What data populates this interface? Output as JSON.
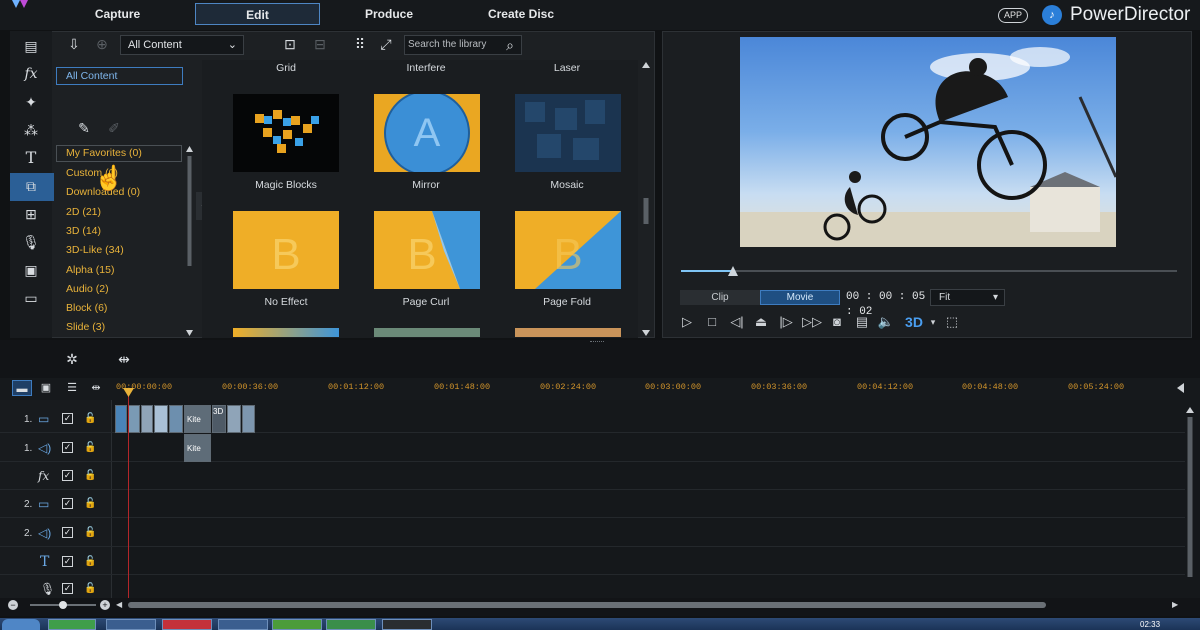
{
  "header": {
    "tabs": [
      {
        "label": "Capture"
      },
      {
        "label": "Edit"
      },
      {
        "label": "Produce"
      },
      {
        "label": "Create Disc"
      }
    ],
    "active_tab": "Edit",
    "app_badge": "APP",
    "brand": "PowerDirector"
  },
  "library": {
    "content_select": "All Content",
    "search_placeholder": "Search the library",
    "all_content_label": "All Content",
    "categories": [
      {
        "label": "My Favorites  (0)"
      },
      {
        "label": "Custom  (0)"
      },
      {
        "label": "Downloaded  (0)"
      },
      {
        "label": "2D  (21)"
      },
      {
        "label": "3D  (14)"
      },
      {
        "label": "3D-Like  (34)"
      },
      {
        "label": "Alpha  (15)"
      },
      {
        "label": "Audio  (2)"
      },
      {
        "label": "Block  (6)"
      },
      {
        "label": "Slide  (3)"
      }
    ],
    "header_labels": [
      "Grid",
      "Interfere",
      "Laser"
    ],
    "thumbnails": [
      {
        "label": "Magic Blocks"
      },
      {
        "label": "Mirror"
      },
      {
        "label": "Mosaic"
      },
      {
        "label": "No Effect"
      },
      {
        "label": "Page Curl"
      },
      {
        "label": "Page Fold"
      }
    ]
  },
  "preview": {
    "mode_clip": "Clip",
    "mode_movie": "Movie",
    "active_mode": "Movie",
    "timecode": "00 : 00 : 05 : 02",
    "fit": "Fit",
    "scrub_position": 0.1,
    "three_d_label": "3D"
  },
  "timeline": {
    "ticks": [
      "00:00:00:00",
      "00:00:36:00",
      "00:01:12:00",
      "00:01:48:00",
      "00:02:24:00",
      "00:03:00:00",
      "00:03:36:00",
      "00:04:12:00",
      "00:04:48:00",
      "00:05:24:00"
    ],
    "tracks": [
      {
        "num": "1.",
        "icon": "video-track-icon"
      },
      {
        "num": "1.",
        "icon": "audio-track-icon"
      },
      {
        "num": "",
        "icon": "fx-track-icon"
      },
      {
        "num": "2.",
        "icon": "video-track-icon"
      },
      {
        "num": "2.",
        "icon": "audio-track-icon"
      },
      {
        "num": "",
        "icon": "title-track-icon"
      },
      {
        "num": "",
        "icon": "voice-track-icon"
      }
    ],
    "clip_labels": {
      "kite_video": "Kite",
      "kite_audio": "Kite",
      "three_d_clip": "3D"
    }
  },
  "taskbar": {
    "time": "02:33"
  },
  "colors": {
    "accent_blue": "#2b5f96",
    "category_text": "#e8b23a",
    "timeline_tick": "#d3952b",
    "playhead": "#b3262a"
  }
}
